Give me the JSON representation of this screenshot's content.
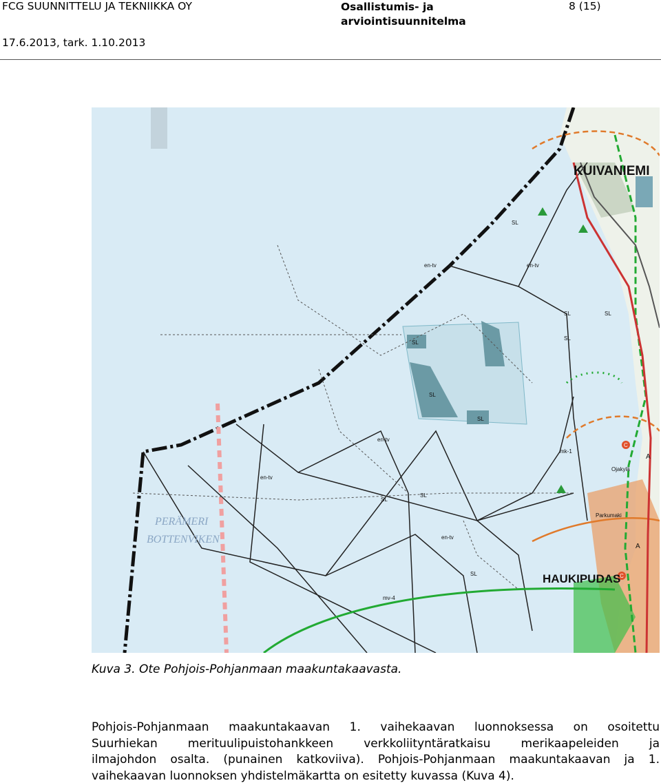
{
  "header": {
    "company": "FCG SUUNNITTELU JA TEKNIIKKA OY",
    "title_line1": "Osallistumis- ja",
    "title_line2": "arviointisuunnitelma",
    "page": "8 (15)",
    "date": "17.6.2013, tark. 1.10.2013"
  },
  "map": {
    "labels": {
      "kuivaniemi": "KUIVANIEMI",
      "haukipudas": "HAUKIPUDAS",
      "perameri": "PERÄMERI",
      "bottenviken": "BOTTENVIKEN",
      "sl": "SL",
      "en_tv": "en-tv",
      "mv4": "mv-4",
      "mk1": "mk-1",
      "oijarvi": "Ojakylä",
      "parkumaki": "Parkumaki",
      "a": "A",
      "c": "C"
    },
    "colors": {
      "sea": "#d9ebf5",
      "border_line": "#111111",
      "cable_red": "#f0a0a0",
      "green_zone": "#22aa33",
      "wind_area": "#6b9aa5",
      "land_orange": "#e9a06a",
      "road_red": "#cc3333"
    }
  },
  "caption": "Kuva 3. Ote Pohjois-Pohjanmaan maakuntakaavasta.",
  "paragraph": {
    "line1": "Pohjois-Pohjanmaan maakuntakaavan 1. vaihekaavan luonnoksessa on osoitettu",
    "line2": "Suurhiekan merituulipuistohankkeen verkkoliityntäratkaisu merikaapeleiden ja",
    "line3": "ilmajohdon osalta. (punainen katkoviiva). Pohjois-Pohjanmaan maakuntakaavan ja 1.",
    "line4": "vaihekaavan luonnoksen yhdistelmäkartta on esitetty kuvassa (Kuva 4)."
  }
}
